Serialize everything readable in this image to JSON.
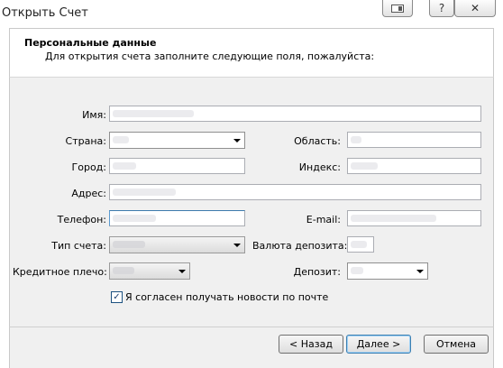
{
  "window": {
    "title": "Открыть Счет",
    "help_label": "?",
    "close_label": "✕"
  },
  "header": {
    "title": "Персональные данные",
    "subtitle": "Для открытия счета заполните следующие поля, пожалуйста:"
  },
  "form": {
    "name_label": "Имя:",
    "country_label": "Страна:",
    "region_label": "Область:",
    "city_label": "Город:",
    "zip_label": "Индекс:",
    "address_label": "Адрес:",
    "phone_label": "Телефон:",
    "email_label": "E-mail:",
    "account_type_label": "Тип счета:",
    "currency_label": "Валюта депозита:",
    "leverage_label": "Кредитное плечо:",
    "deposit_label": "Депозит:",
    "newsletter_label": "Я согласен получать новости по почте",
    "newsletter_checked": true
  },
  "buttons": {
    "back": "< Назад",
    "next": "Далее >",
    "cancel": "Отмена"
  },
  "icons": {
    "mode": "window-mode-icon",
    "check": "✓"
  }
}
